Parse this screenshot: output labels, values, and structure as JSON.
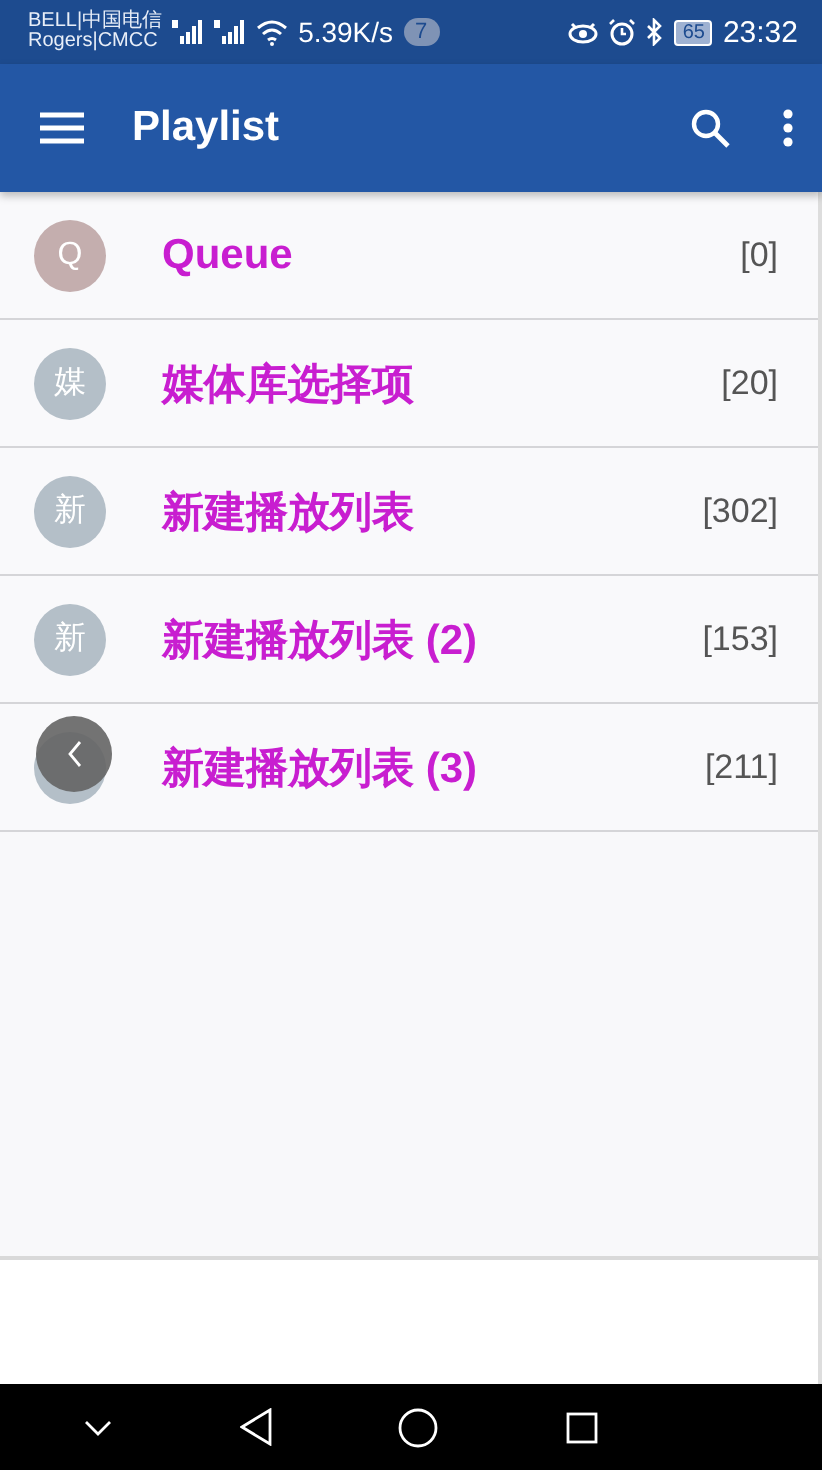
{
  "status_bar": {
    "carrier_1": "BELL|中国电信",
    "carrier_2": "Rogers|CMCC",
    "speed": "5.39K/s",
    "notification_count": "7",
    "battery": "65",
    "time": "23:32"
  },
  "app_bar": {
    "title": "Playlist"
  },
  "playlists": [
    {
      "avatar": "Q",
      "name": "Queue",
      "count": "[0]",
      "color": "#c4aeae"
    },
    {
      "avatar": "媒",
      "name": "媒体库选择项",
      "count": "[20]",
      "color": "#b4bfc8"
    },
    {
      "avatar": "新",
      "name": "新建播放列表",
      "count": "[302]",
      "color": "#b4bfc8"
    },
    {
      "avatar": "新",
      "name": "新建播放列表 (2)",
      "count": "[153]",
      "color": "#b4bfc8"
    },
    {
      "name": "新建播放列表 (3)",
      "count": "[211]",
      "color": "#b4bfc8"
    }
  ]
}
